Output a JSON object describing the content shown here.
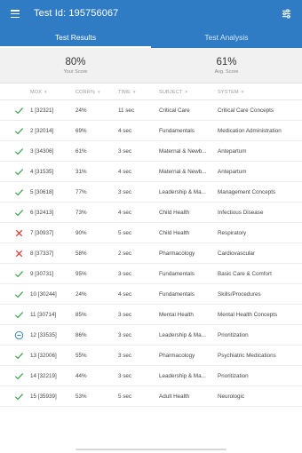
{
  "header": {
    "title": "Test Id: 195756067",
    "menu_icon": "menu-icon",
    "filter_icon": "sliders-icon",
    "color": "#2f7bc4"
  },
  "tabs": [
    {
      "label": "Test Results",
      "active": true
    },
    {
      "label": "Test Analysis",
      "active": false
    }
  ],
  "summary": {
    "your_score": {
      "value": "80%",
      "label": "Your Score"
    },
    "avg_score": {
      "value": "61%",
      "label": "Avg. Score"
    }
  },
  "columns": [
    "MOX",
    "CORR%",
    "TIME",
    "SUBJECT",
    "SYSTEM"
  ],
  "status_colors": {
    "correct": "#3aa34a",
    "incorrect": "#d9342b",
    "omitted": "#2f7bc4"
  },
  "rows": [
    {
      "status": "correct",
      "num": "1 [32321]",
      "corr": "24%",
      "time": "11 sec",
      "subject": "Critical Care",
      "system": "Critical Care Concepts"
    },
    {
      "status": "correct",
      "num": "2 [32014]",
      "corr": "69%",
      "time": "4 sec",
      "subject": "Fundamentals",
      "system": "Medication Administration"
    },
    {
      "status": "correct",
      "num": "3 [34306]",
      "corr": "61%",
      "time": "3 sec",
      "subject": "Maternal & Newb...",
      "system": "Antepartum"
    },
    {
      "status": "correct",
      "num": "4 [31535]",
      "corr": "31%",
      "time": "4 sec",
      "subject": "Maternal & Newb...",
      "system": "Antepartum"
    },
    {
      "status": "correct",
      "num": "5 [30618]",
      "corr": "77%",
      "time": "3 sec",
      "subject": "Leadership & Ma...",
      "system": "Management Concepts"
    },
    {
      "status": "correct",
      "num": "6 [32413]",
      "corr": "73%",
      "time": "4 sec",
      "subject": "Child Health",
      "system": "Infectious Disease"
    },
    {
      "status": "incorrect",
      "num": "7 [30937]",
      "corr": "90%",
      "time": "5 sec",
      "subject": "Child Health",
      "system": "Respiratory"
    },
    {
      "status": "incorrect",
      "num": "8 [37337]",
      "corr": "58%",
      "time": "2 sec",
      "subject": "Pharmacology",
      "system": "Cardiovascular"
    },
    {
      "status": "correct",
      "num": "9 [30731]",
      "corr": "95%",
      "time": "3 sec",
      "subject": "Fundamentals",
      "system": "Basic Care & Comfort"
    },
    {
      "status": "correct",
      "num": "10 [30244]",
      "corr": "24%",
      "time": "4 sec",
      "subject": "Fundamentals",
      "system": "Skills/Procedures"
    },
    {
      "status": "correct",
      "num": "11 [30714]",
      "corr": "85%",
      "time": "3 sec",
      "subject": "Mental Health",
      "system": "Mental Health Concepts"
    },
    {
      "status": "omitted",
      "num": "12 [33535]",
      "corr": "86%",
      "time": "3 sec",
      "subject": "Leadership & Ma...",
      "system": "Prioritization"
    },
    {
      "status": "correct",
      "num": "13 [32006]",
      "corr": "55%",
      "time": "3 sec",
      "subject": "Pharmacology",
      "system": "Psychiatric Medications"
    },
    {
      "status": "correct",
      "num": "14 [32219]",
      "corr": "44%",
      "time": "3 sec",
      "subject": "Leadership & Ma...",
      "system": "Prioritization"
    },
    {
      "status": "correct",
      "num": "15 [35939]",
      "corr": "53%",
      "time": "5 sec",
      "subject": "Adult Health",
      "system": "Neurologic"
    }
  ]
}
